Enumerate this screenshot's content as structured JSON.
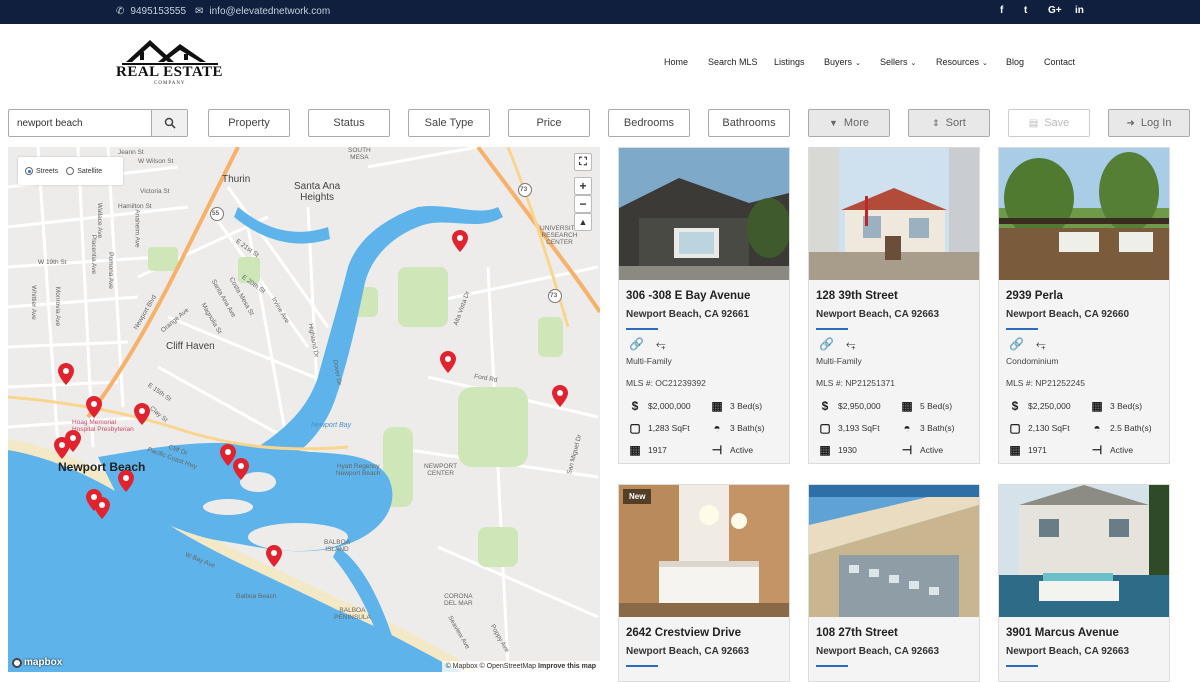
{
  "topbar": {
    "phone": "9495153555",
    "email": "info@elevatednetwork.com",
    "social": [
      "f",
      "t",
      "G+",
      "in"
    ]
  },
  "logo": {
    "line1": "REAL ESTATE",
    "line2": "COMPANY"
  },
  "nav": [
    {
      "label": "Home"
    },
    {
      "label": "Search MLS"
    },
    {
      "label": "Listings"
    },
    {
      "label": "Buyers",
      "dropdown": true
    },
    {
      "label": "Sellers",
      "dropdown": true
    },
    {
      "label": "Resources",
      "dropdown": true
    },
    {
      "label": "Blog"
    },
    {
      "label": "Contact"
    }
  ],
  "search": {
    "value": "newport beach",
    "placeholder": ""
  },
  "filters": {
    "property": "Property",
    "status": "Status",
    "sale_type": "Sale Type",
    "price": "Price",
    "bedrooms": "Bedrooms",
    "bathrooms": "Bathrooms",
    "more": "More",
    "sort": "Sort",
    "save": "Save",
    "login": "Log In"
  },
  "map": {
    "layer_options": {
      "streets": "Streets",
      "satellite": "Satellite",
      "selected": "Streets"
    },
    "labels": {
      "newport_beach": "Newport Beach",
      "santa_ana_heights": "Santa Ana\nHeights",
      "thurin": "Thurin",
      "cliff_haven": "Cliff Haven",
      "south_mesa": "SOUTH\nMESA",
      "university": "UNIVERSITY\nRESEARCH\nCENTER",
      "newport_center": "NEWPORT\nCENTER",
      "balboa_island": "BALBOA\nISLAND",
      "balboa_peninsula": "BALBOA\nPENINSULA",
      "corona_del_mar": "CORONA\nDEL MAR",
      "hoag": "Hoag Memorial\nHospital Presbyterian",
      "hyatt": "Hyatt Regency\nNewport Beach",
      "balboa_beach": "Balboa Beach",
      "newport_bay": "Newport Bay",
      "w_wilson": "W Wilson St",
      "victoria": "Victoria St",
      "hamilton": "Hamilton St",
      "w_19th": "W 19th St",
      "w_bay": "W Bay Ave",
      "pch": "Pacific Coast Hwy",
      "ford": "Ford Rd",
      "e_21st": "E 21st St",
      "e_20th": "E 20th St",
      "e_15th": "E 15th St",
      "irvine": "Irvine Ave",
      "highland": "Highland Dr",
      "dover": "Dover Dr",
      "santa_ana": "Santa Ana Ave",
      "costa_mesa": "Costa Mesa St",
      "magnolia": "Magnolia St",
      "placentia": "Placentia Ave",
      "pomona": "Pomona Ave",
      "monrovia": "Monrovia Ave",
      "whittier": "Whittier Ave",
      "wallace": "Wallace Ave",
      "anaheim": "Anaheim Ave",
      "orange": "Orange Ave",
      "clay": "Clay St",
      "cliff_dr": "Cliff Dr",
      "newport_blvd": "Newport Blvd",
      "alta_vista": "Alta Vista Dr",
      "san_miguel": "San Miguel Dr",
      "seaview": "Seaview Ave",
      "poppy": "Poppy Ave",
      "jeanne": "Jeann St"
    },
    "shields": [
      "55",
      "73",
      "73"
    ],
    "attribution": {
      "mapbox": "© Mapbox",
      "osm": "© OpenStreetMap",
      "improve": "Improve this map"
    },
    "brand": "mapbox"
  },
  "listings": [
    {
      "address": "306 -308 E Bay Avenue",
      "city": "Newport Beach, CA 92661",
      "type": "Multi-Family",
      "mls": "MLS #: OC21239392",
      "price": "$2,000,000",
      "beds": "3 Bed(s)",
      "sqft": "1,283 SqFt",
      "baths": "3 Bath(s)",
      "year": "1917",
      "status": "Active",
      "badge": ""
    },
    {
      "address": "128 39th Street",
      "city": "Newport Beach, CA 92663",
      "type": "Multi-Family",
      "mls": "MLS #: NP21251371",
      "price": "$2,950,000",
      "beds": "5 Bed(s)",
      "sqft": "3,193 SqFt",
      "baths": "3 Bath(s)",
      "year": "1930",
      "status": "Active",
      "badge": ""
    },
    {
      "address": "2939 Perla",
      "city": "Newport Beach, CA 92660",
      "type": "Condominium",
      "mls": "MLS #: NP21252245",
      "price": "$2,250,000",
      "beds": "3 Bed(s)",
      "sqft": "2,130 SqFt",
      "baths": "2.5 Bath(s)",
      "year": "1971",
      "status": "Active",
      "badge": ""
    },
    {
      "address": "2642 Crestview Drive",
      "city": "Newport Beach, CA 92663",
      "badge": "New"
    },
    {
      "address": "108 27th Street",
      "city": "Newport Beach, CA 92663",
      "badge": ""
    },
    {
      "address": "3901 Marcus Avenue",
      "city": "Newport Beach, CA 92663",
      "badge": ""
    }
  ],
  "colors": {
    "topbar": "#0f1f3d",
    "accent": "#2a6ebb",
    "pin": "#e0232e",
    "water": "#5eb4ea",
    "park": "#cfe6b8"
  }
}
